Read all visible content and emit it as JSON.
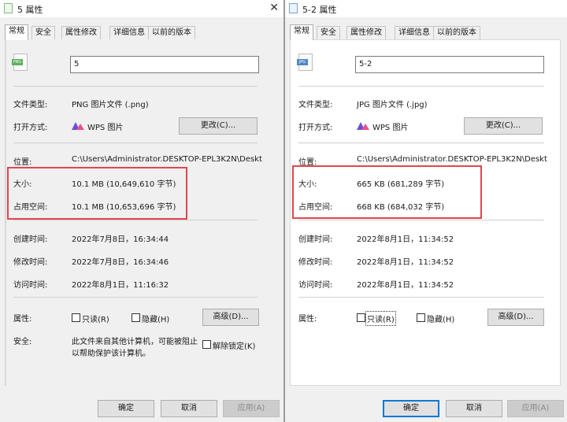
{
  "common": {
    "tabs": [
      "常规",
      "安全",
      "属性修改",
      "详细信息",
      "以前的版本"
    ],
    "labels": {
      "file_type": "文件类型:",
      "open_with": "打开方式:",
      "location": "位置:",
      "size": "大小:",
      "size_on_disk": "占用空间:",
      "created": "创建时间:",
      "modified": "修改时间:",
      "accessed": "访问时间:",
      "attributes": "属性:",
      "security": "安全:"
    },
    "change_button": "更改(C)...",
    "advanced_button": "高级(D)...",
    "readonly_label": "只读(R)",
    "hidden_label": "隐藏(H)",
    "ok_button": "确定",
    "cancel_button": "取消",
    "apply_button": "应用(A)",
    "close_glyph": "✕",
    "accent_highlight": "#e0464f"
  },
  "left": {
    "title": "5 属性",
    "filename": "5",
    "icon_badge": "PNG",
    "file_type": "PNG 图片文件 (.png)",
    "open_with": "WPS 图片",
    "location": "C:\\Users\\Administrator.DESKTOP-EPL3K2N\\Deskt",
    "size": "10.1 MB (10,649,610 字节)",
    "size_on_disk": "10.1 MB (10,653,696 字节)",
    "created": "2022年7月8日，16:34:44",
    "modified": "2022年7月8日，16:34:46",
    "accessed": "2022年8月1日，11:16:32",
    "security_text_line1": "此文件来自其他计算机，可能被阻止",
    "security_text_line2": "以帮助保护该计算机。",
    "unblock_label": "解除锁定(K)"
  },
  "right": {
    "title": "5-2 属性",
    "filename": "5-2",
    "icon_badge": "JPG",
    "file_type": "JPG 图片文件 (.jpg)",
    "open_with": "WPS 图片",
    "location": "C:\\Users\\Administrator.DESKTOP-EPL3K2N\\Deskt",
    "size": "665 KB (681,289 字节)",
    "size_on_disk": "668 KB (684,032 字节)",
    "created": "2022年8月1日，11:34:52",
    "modified": "2022年8月1日，11:34:52",
    "accessed": "2022年8月1日，11:34:52"
  }
}
